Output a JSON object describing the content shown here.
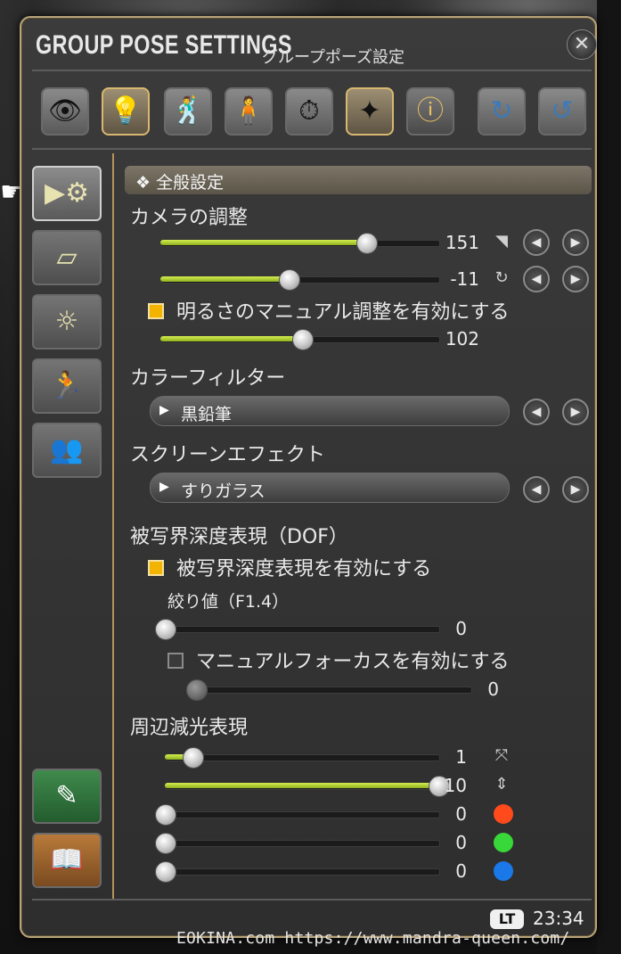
{
  "window": {
    "title": "GROUP POSE SETTINGS",
    "subtitle": "グループポーズ設定",
    "close_icon": "close-x-icon"
  },
  "toolbar": {
    "icons": [
      {
        "name": "eye-icon",
        "glyph": "👁",
        "active": false
      },
      {
        "name": "lamp-icon",
        "glyph": "💡",
        "active": true
      },
      {
        "name": "character-pose-icon",
        "glyph": "🕺",
        "active": false
      },
      {
        "name": "character-face-icon",
        "glyph": "🧍",
        "active": false
      },
      {
        "name": "time-weather-lock-icon",
        "glyph": "⏱",
        "active": false
      },
      {
        "name": "effect-burst-icon",
        "glyph": "✦",
        "active": true
      },
      {
        "name": "info-icon",
        "glyph": "ⓘ",
        "active": false
      },
      {
        "name": "reset-rotate-icon",
        "glyph": "↻",
        "active": false
      },
      {
        "name": "reset-rotate-alt-icon",
        "glyph": "↺",
        "active": false
      }
    ]
  },
  "sidebar": {
    "icons": [
      {
        "name": "camera-settings-icon",
        "glyph": "▶⚙",
        "active": true
      },
      {
        "name": "frame-filter-icon",
        "glyph": "▱"
      },
      {
        "name": "lighting-icon",
        "glyph": "☼"
      },
      {
        "name": "motion-icon",
        "glyph": "🏃"
      },
      {
        "name": "group-characters-icon",
        "glyph": "👥"
      },
      {
        "name": "edit-book-icon",
        "glyph": "✎"
      },
      {
        "name": "help-book-icon",
        "glyph": "📖"
      }
    ]
  },
  "section": {
    "header": "❖ 全般設定"
  },
  "camera": {
    "label": "カメラの調整",
    "slider1": {
      "value": "151",
      "fraction": 0.74,
      "icon": "wifi-signal-icon"
    },
    "slider2": {
      "value": "-11",
      "fraction": 0.46,
      "icon": "rotate-icon"
    },
    "manual_brightness": {
      "label": "明るさのマニュアル調整を有効にする",
      "checked": true
    },
    "brightness": {
      "value": "102",
      "fraction": 0.51
    }
  },
  "color_filter": {
    "label": "カラーフィルター",
    "value": "黒鉛筆"
  },
  "screen_effect": {
    "label": "スクリーンエフェクト",
    "value": "すりガラス"
  },
  "dof": {
    "label": "被写界深度表現（DOF）",
    "enable": {
      "label": "被写界深度表現を有効にする",
      "checked": true
    },
    "aperture_label": "絞り値（F1.4）",
    "aperture": {
      "value": "0",
      "fraction": 0.0
    },
    "manual_focus": {
      "label": "マニュアルフォーカスを有効にする",
      "checked": false
    },
    "focus": {
      "value": "0",
      "fraction": 0.0
    }
  },
  "vignette": {
    "label": "周辺減光表現",
    "sliders": [
      {
        "value": "1",
        "fraction": 0.1,
        "icon": "expand-icon",
        "color": null
      },
      {
        "value": "10",
        "fraction": 1.0,
        "icon": "vertical-resize-icon",
        "color": null
      },
      {
        "value": "0",
        "fraction": 0.0,
        "icon": "red-color-icon",
        "color": "#ff4a1c"
      },
      {
        "value": "0",
        "fraction": 0.0,
        "icon": "green-color-icon",
        "color": "#38d838"
      },
      {
        "value": "0",
        "fraction": 0.0,
        "icon": "blue-color-icon",
        "color": "#1a78e8"
      }
    ]
  },
  "footer": {
    "lt_badge": "LT",
    "clock": "23:34",
    "watermark": "EOKINA.com  https://www.mandra-queen.com/"
  },
  "arrows": {
    "left": "◀",
    "right": "▶"
  }
}
